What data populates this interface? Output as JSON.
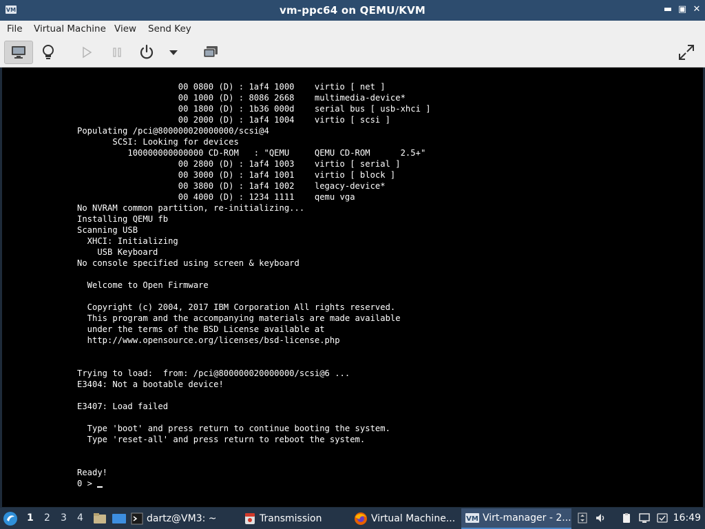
{
  "window": {
    "title": "vm-ppc64 on QEMU/KVM"
  },
  "menu": [
    "File",
    "Virtual Machine",
    "View",
    "Send Key"
  ],
  "toolbar": {
    "icons": [
      "monitor-icon",
      "lightbulb-icon",
      "play-icon",
      "pause-icon",
      "power-icon",
      "chevron-down-icon",
      "snapshot-icon",
      "fullscreen-icon"
    ]
  },
  "console": {
    "lines": [
      "                    00 0800 (D) : 1af4 1000    virtio [ net ]",
      "                    00 1000 (D) : 8086 2668    multimedia-device*",
      "                    00 1800 (D) : 1b36 000d    serial bus [ usb-xhci ]",
      "                    00 2000 (D) : 1af4 1004    virtio [ scsi ]",
      "Populating /pci@800000020000000/scsi@4",
      "       SCSI: Looking for devices",
      "          100000000000000 CD-ROM   : \"QEMU     QEMU CD-ROM      2.5+\"",
      "                    00 2800 (D) : 1af4 1003    virtio [ serial ]",
      "                    00 3000 (D) : 1af4 1001    virtio [ block ]",
      "                    00 3800 (D) : 1af4 1002    legacy-device*",
      "                    00 4000 (D) : 1234 1111    qemu vga",
      "No NVRAM common partition, re-initializing...",
      "Installing QEMU fb",
      "Scanning USB",
      "  XHCI: Initializing",
      "    USB Keyboard",
      "No console specified using screen & keyboard",
      "",
      "  Welcome to Open Firmware",
      "",
      "  Copyright (c) 2004, 2017 IBM Corporation All rights reserved.",
      "  This program and the accompanying materials are made available",
      "  under the terms of the BSD License available at",
      "  http://www.opensource.org/licenses/bsd-license.php",
      "",
      "",
      "Trying to load:  from: /pci@800000020000000/scsi@6 ...",
      "E3404: Not a bootable device!",
      "",
      "E3407: Load failed",
      "",
      "  Type 'boot' and press return to continue booting the system.",
      "  Type 'reset-all' and press return to reboot the system.",
      "",
      "",
      "Ready!"
    ],
    "prompt": "0 > "
  },
  "taskbar": {
    "workspaces": [
      "1",
      "2",
      "3",
      "4"
    ],
    "tasks": [
      {
        "label": "dartz@VM3: ~",
        "icon": "terminal-icon"
      },
      {
        "label": "Transmission",
        "icon": "transmission-icon"
      },
      {
        "label": "Virtual Machine...",
        "icon": "firefox-icon"
      },
      {
        "label": "Virt-manager - 2...",
        "icon": "virt-manager-icon"
      }
    ],
    "clock": "16:49"
  }
}
